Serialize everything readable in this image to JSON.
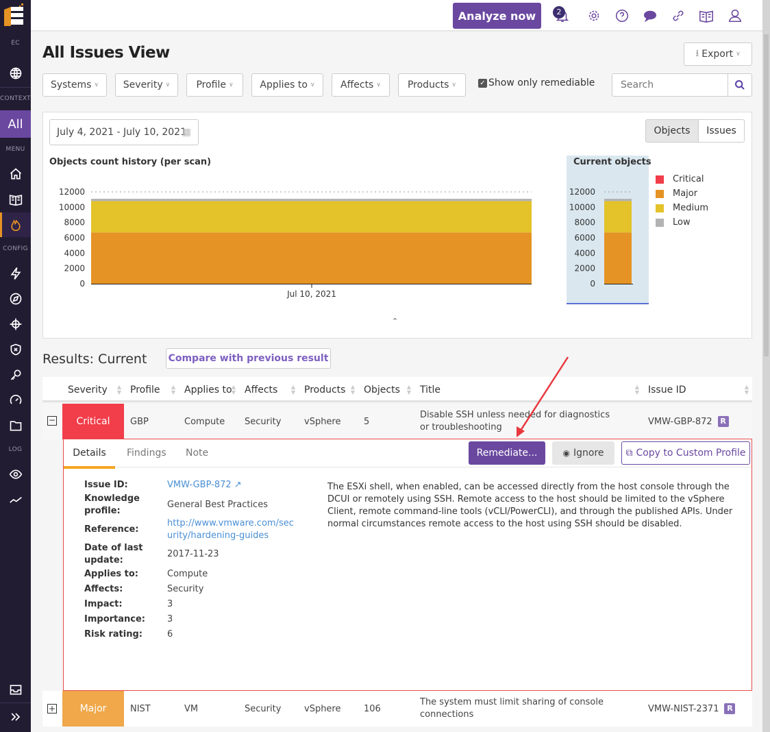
{
  "sidebar": {
    "org": "EC",
    "context_label": "CONTEXT",
    "context_value": "All",
    "menu_label": "MENU",
    "config_label": "CONFIG",
    "log_label": "LOG"
  },
  "header": {
    "analyze_label": "Analyze now",
    "notification_count": "2"
  },
  "page": {
    "title": "All Issues View",
    "export_label": "Export"
  },
  "filters": {
    "items": [
      "Systems",
      "Severity",
      "Profile",
      "Applies to",
      "Affects",
      "Products"
    ],
    "remediable_label": "Show only remediable",
    "remediable_checked": true,
    "search_placeholder": "Search"
  },
  "date_range": "July 4, 2021 - July 10, 2021",
  "view_toggle": {
    "objects": "Objects",
    "issues": "Issues",
    "active": "Objects"
  },
  "chart_data": [
    {
      "type": "area",
      "title": "Objects count history (per scan)",
      "x": [
        "Jul 10, 2021"
      ],
      "ylim": [
        0,
        12000
      ],
      "yticks": [
        "0",
        "2000",
        "4000",
        "6000",
        "8000",
        "10000",
        "12000"
      ],
      "series": [
        {
          "name": "Critical",
          "values": [
            0
          ]
        },
        {
          "name": "Major",
          "values": [
            6700
          ]
        },
        {
          "name": "Medium",
          "values": [
            4100
          ]
        },
        {
          "name": "Low",
          "values": [
            300
          ]
        }
      ]
    },
    {
      "type": "bar",
      "title": "Current objects",
      "ylim": [
        0,
        12000
      ],
      "yticks": [
        "0",
        "2000",
        "4000",
        "6000",
        "8000",
        "10000",
        "12000"
      ],
      "series": [
        {
          "name": "Critical",
          "values": [
            0
          ]
        },
        {
          "name": "Major",
          "values": [
            6700
          ]
        },
        {
          "name": "Medium",
          "values": [
            4100
          ]
        },
        {
          "name": "Low",
          "values": [
            300
          ]
        }
      ],
      "legend": "right"
    }
  ],
  "colors": {
    "Critical": "#f23d4a",
    "Major": "#e59324",
    "Medium": "#e3c22a",
    "Low": "#b3b3b3",
    "accent": "#6a48a0"
  },
  "results": {
    "title": "Results: Current",
    "compare_label": "Compare with previous result"
  },
  "table": {
    "columns": [
      "Severity",
      "Profile",
      "Applies to",
      "Affects",
      "Products",
      "Objects",
      "Title",
      "Issue ID"
    ],
    "rows": [
      {
        "severity": "Critical",
        "profile": "GBP",
        "applies_to": "Compute",
        "affects": "Security",
        "products": "vSphere",
        "objects": "5",
        "title": "Disable SSH unless needed for diagnostics or troubleshooting",
        "issue_id": "VMW-GBP-872",
        "badge": "R"
      },
      {
        "severity": "Major",
        "profile": "NIST",
        "applies_to": "VM",
        "affects": "Security",
        "products": "vSphere",
        "objects": "106",
        "title": "The system must limit sharing of console connections",
        "issue_id": "VMW-NIST-2371",
        "badge": "R"
      }
    ]
  },
  "details": {
    "tabs": [
      "Details",
      "Findings",
      "Note"
    ],
    "remediate_label": "Remediate...",
    "ignore_label": "Ignore",
    "copy_label": "Copy to Custom Profile",
    "fields": [
      {
        "label": "Issue ID:",
        "value": "VMW-GBP-872"
      },
      {
        "label": "Knowledge profile:",
        "value": "General Best Practices"
      },
      {
        "label": "Reference:",
        "value": "http://www.vmware.com/security/hardening-guides"
      },
      {
        "label": "Date of last update:",
        "value": "2017-11-23"
      },
      {
        "label": "Applies to:",
        "value": "Compute"
      },
      {
        "label": "Affects:",
        "value": "Security"
      },
      {
        "label": "Impact:",
        "value": "3"
      },
      {
        "label": "Importance:",
        "value": "3"
      },
      {
        "label": "Risk rating:",
        "value": "6"
      }
    ],
    "description": "The ESXi shell, when enabled, can be accessed directly from the host console through the DCUI or remotely using SSH. Remote access to the host should be limited to the vSphere Client, remote command-line tools (vCLI/PowerCLI), and through the published APIs. Under normal circumstances remote access to the host using SSH should be disabled."
  }
}
